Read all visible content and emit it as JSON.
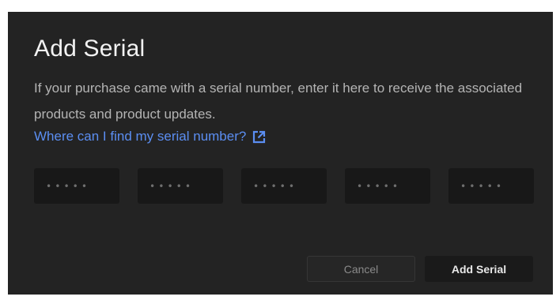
{
  "dialog": {
    "title": "Add Serial",
    "description": "If your purchase came with a serial number, enter it here to receive the associated products and product updates.",
    "help_link": {
      "label": "Where can I find my serial number?",
      "icon": "external-link-icon"
    },
    "serial_fields": [
      {
        "value": "",
        "placeholder": "•••••"
      },
      {
        "value": "",
        "placeholder": "•••••"
      },
      {
        "value": "",
        "placeholder": "•••••"
      },
      {
        "value": "",
        "placeholder": "•••••"
      },
      {
        "value": "",
        "placeholder": "•••••"
      }
    ],
    "buttons": {
      "cancel_label": "Cancel",
      "add_label": "Add Serial"
    }
  },
  "colors": {
    "dialog_background": "#232323",
    "link": "#5b8ef2",
    "field_background": "#181818"
  }
}
